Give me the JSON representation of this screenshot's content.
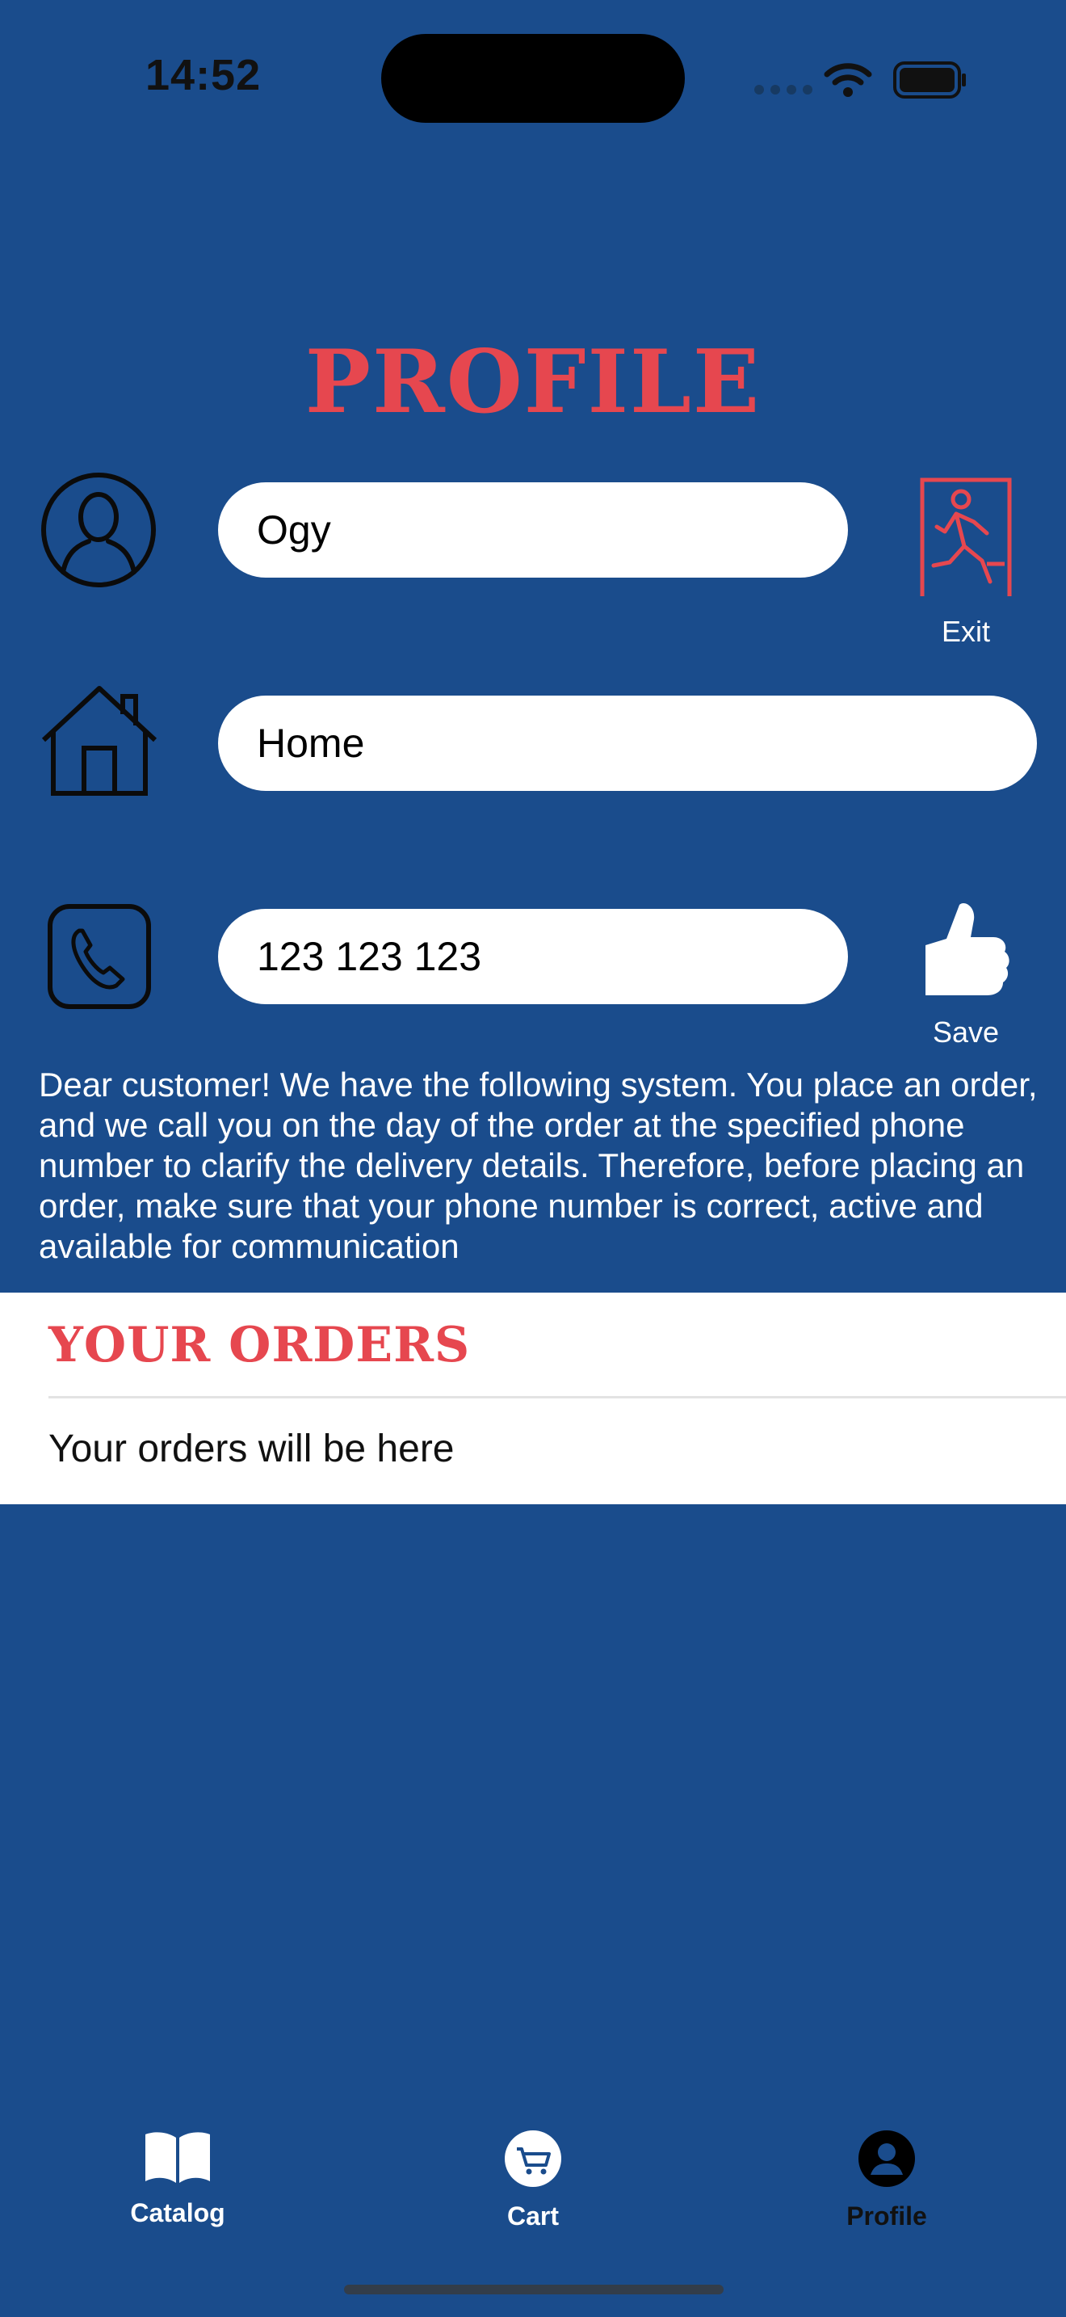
{
  "status_bar": {
    "time": "14:52"
  },
  "header": {
    "title": "PROFILE"
  },
  "form": {
    "name_value": "Ogy",
    "address_value": "Home",
    "phone_value": "123 123 123"
  },
  "actions": {
    "exit_label": "Exit",
    "save_label": "Save"
  },
  "notice": "Dear customer! We have the following system. You place an order, and we call you on the day of the order at the specified phone number to clarify the delivery details. Therefore, before placing an order, make sure that your phone number is correct, active and available for communication",
  "orders": {
    "title": "YOUR ORDERS",
    "empty_text": "Your orders will be here"
  },
  "tabs": [
    {
      "label": "Catalog",
      "icon": "book-icon"
    },
    {
      "label": "Cart",
      "icon": "cart-icon"
    },
    {
      "label": "Profile",
      "icon": "person-icon",
      "active": true
    }
  ],
  "colors": {
    "background": "#1a4c8c",
    "accent": "#e6474f",
    "panel": "#ffffff"
  }
}
